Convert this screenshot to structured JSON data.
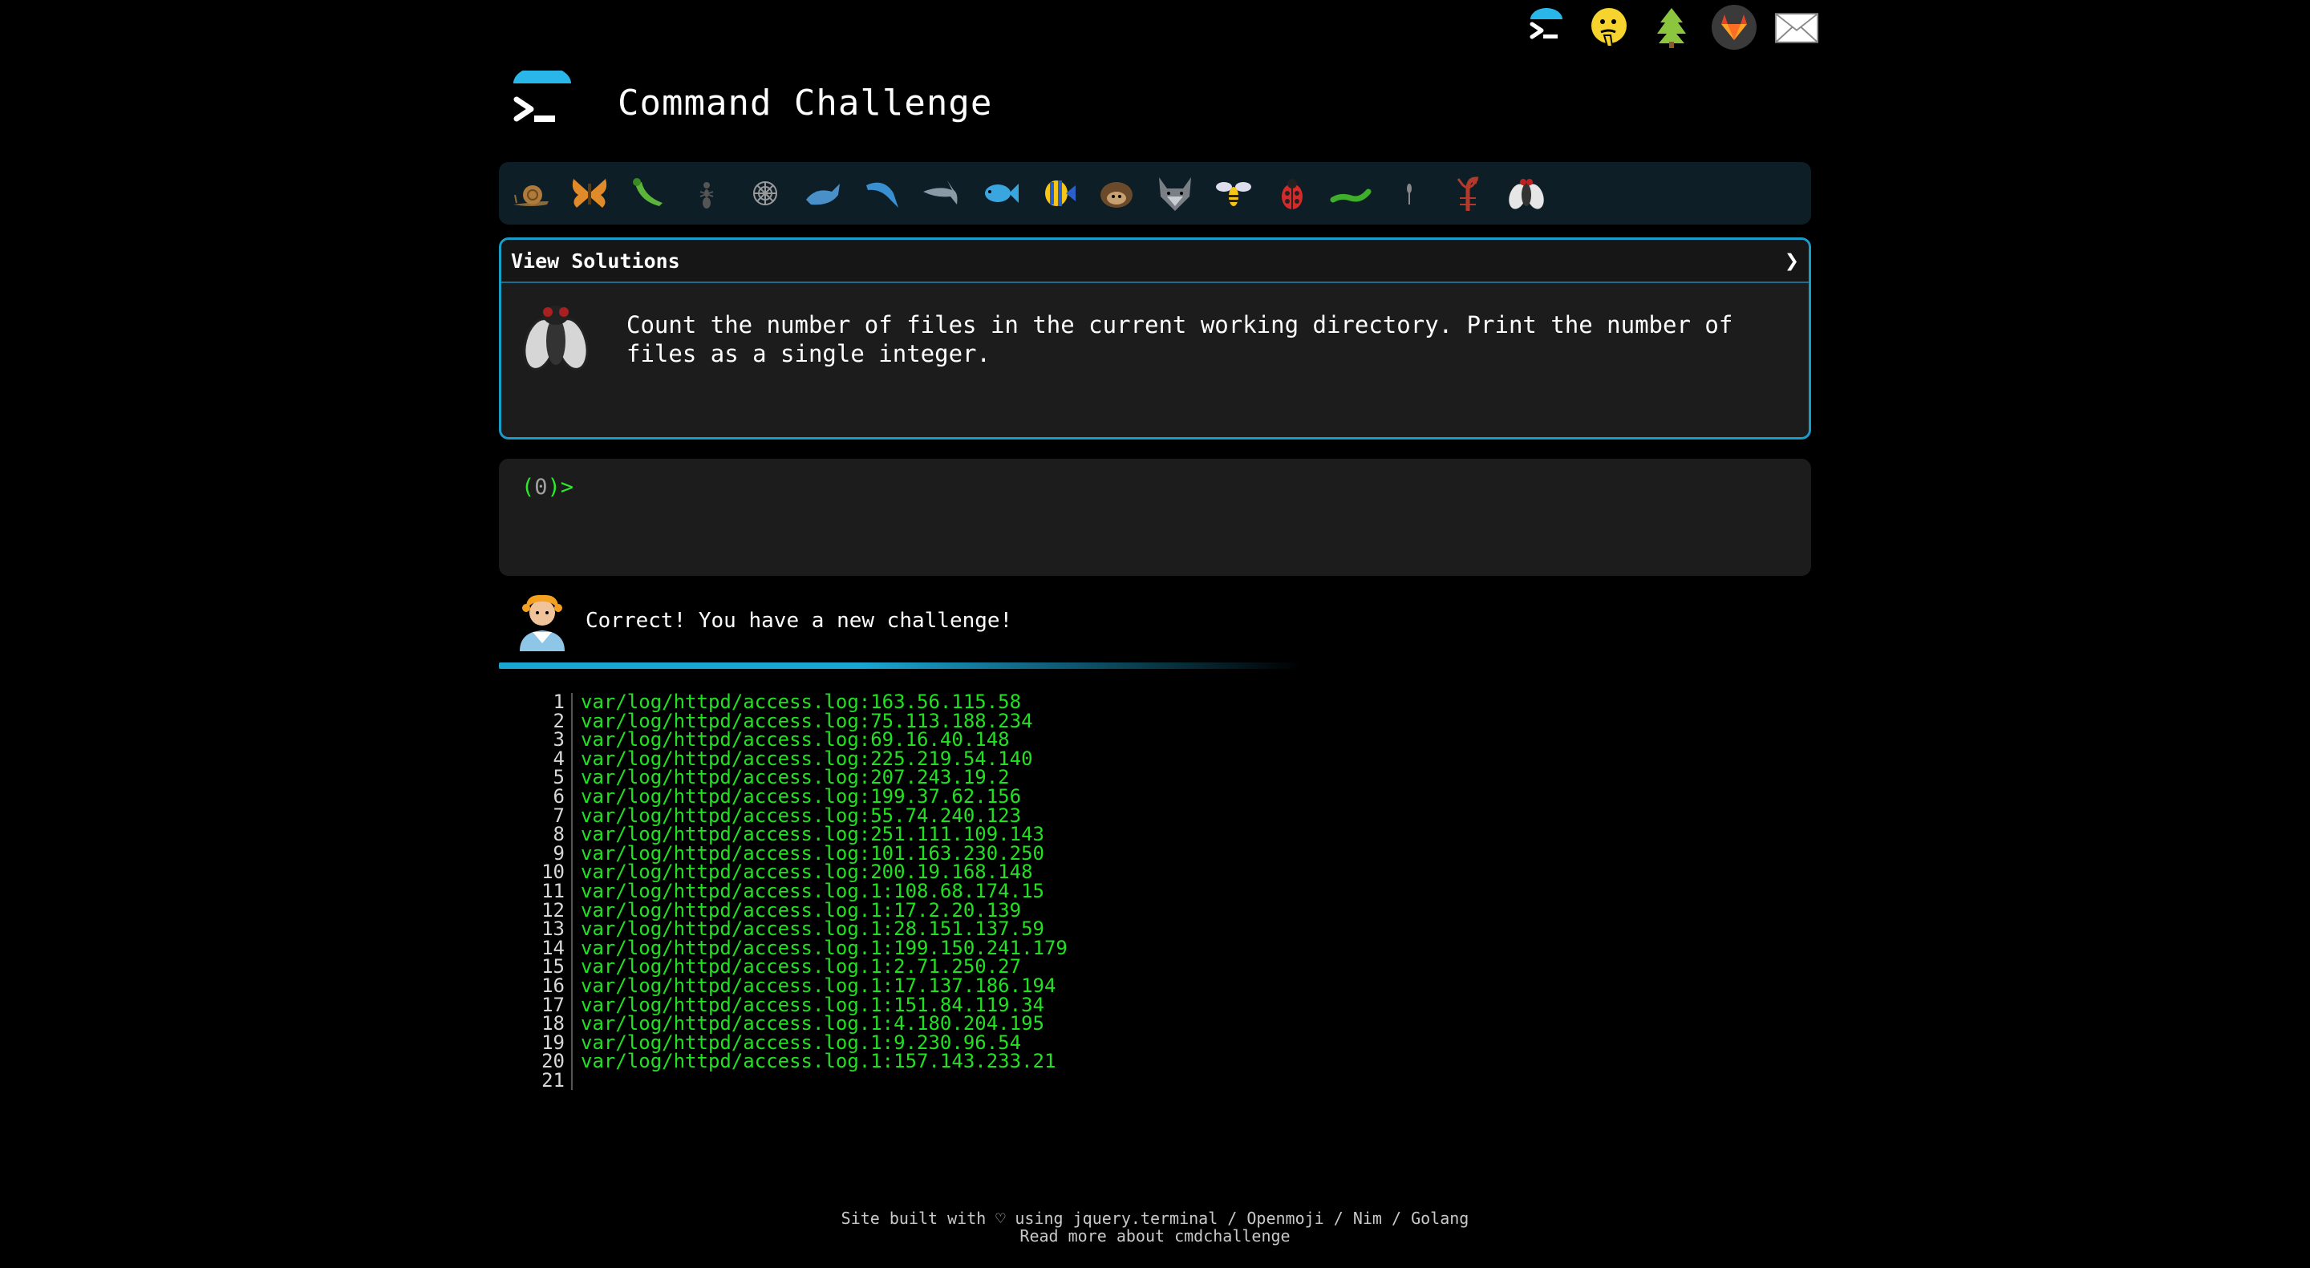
{
  "header": {
    "title": "Command Challenge"
  },
  "top_icons": [
    {
      "name": "terminal-logo-icon"
    },
    {
      "name": "hint-face-icon"
    },
    {
      "name": "tree-icon"
    },
    {
      "name": "gitlab-icon"
    },
    {
      "name": "mail-icon"
    }
  ],
  "challenge_icons": [
    "snail",
    "butterfly",
    "caterpillar",
    "ant",
    "spider-web",
    "whale",
    "dolphin",
    "shark",
    "fish",
    "tropical-fish",
    "hedgehog",
    "wolf",
    "bee",
    "ladybug",
    "worm",
    "mosquito",
    "scorpion",
    "fly"
  ],
  "challenge": {
    "view_solutions_label": "View Solutions",
    "chevron": "❯",
    "description": "Count the number of files in the current working directory. Print the number of files as a single integer."
  },
  "terminal": {
    "prompt_open": "(",
    "prompt_zero": "0",
    "prompt_close": ")>"
  },
  "result": {
    "message": "Correct! You have a new challenge!"
  },
  "output": {
    "lines": [
      "var/log/httpd/access.log:163.56.115.58",
      "var/log/httpd/access.log:75.113.188.234",
      "var/log/httpd/access.log:69.16.40.148",
      "var/log/httpd/access.log:225.219.54.140",
      "var/log/httpd/access.log:207.243.19.2",
      "var/log/httpd/access.log:199.37.62.156",
      "var/log/httpd/access.log:55.74.240.123",
      "var/log/httpd/access.log:251.111.109.143",
      "var/log/httpd/access.log:101.163.230.250",
      "var/log/httpd/access.log:200.19.168.148",
      "var/log/httpd/access.log.1:108.68.174.15",
      "var/log/httpd/access.log.1:17.2.20.139",
      "var/log/httpd/access.log.1:28.151.137.59",
      "var/log/httpd/access.log.1:199.150.241.179",
      "var/log/httpd/access.log.1:2.71.250.27",
      "var/log/httpd/access.log.1:17.137.186.194",
      "var/log/httpd/access.log.1:151.84.119.34",
      "var/log/httpd/access.log.1:4.180.204.195",
      "var/log/httpd/access.log.1:9.230.96.54",
      "var/log/httpd/access.log.1:157.143.233.21",
      ""
    ]
  },
  "footer": {
    "line1": "Site built with ♡ using jquery.terminal / Openmoji / Nim / Golang",
    "line2": "Read more about cmdchallenge"
  },
  "colors": {
    "accent": "#1a9cc8",
    "terminal_green": "#2ee82e",
    "panel_bg": "#1c1c1c",
    "bar_bg": "#0d1e27"
  }
}
